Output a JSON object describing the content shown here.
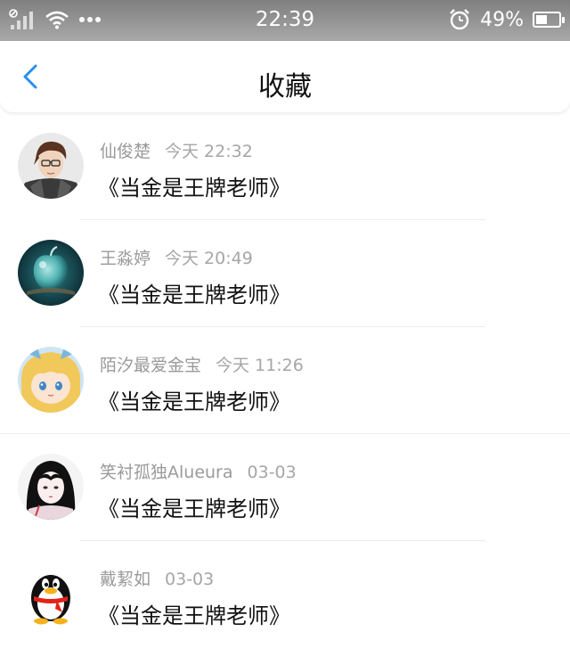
{
  "status_bar": {
    "time": "22:39",
    "battery": "49%",
    "battery_level": 0.49,
    "icons": [
      "no-sim-signal-icon",
      "wifi-icon",
      "more-dots-icon",
      "alarm-icon",
      "battery-icon"
    ]
  },
  "header": {
    "title": "收藏",
    "back_icon": "chevron-left-icon",
    "accent_color": "#2a8ee8"
  },
  "favorites": [
    {
      "name": "仙俊楚",
      "time": "今天 22:32",
      "content": "《当金是王牌老师》",
      "avatar": "anime-boy-glasses-avatar"
    },
    {
      "name": "王淼婷",
      "time": "今天 20:49",
      "content": "《当金是王牌老师》",
      "avatar": "glass-apple-avatar"
    },
    {
      "name": "陌汐最爱金宝",
      "time": "今天 11:26",
      "content": "《当金是王牌老师》",
      "avatar": "anime-blonde-avatar"
    },
    {
      "name": "笑衬孤独Alueura",
      "time": "03-03",
      "content": "《当金是王牌老师》",
      "avatar": "anime-girl-avatar"
    },
    {
      "name": "戴絜如",
      "time": "03-03",
      "content": "《当金是王牌老师》",
      "avatar": "qq-penguin-avatar"
    }
  ]
}
